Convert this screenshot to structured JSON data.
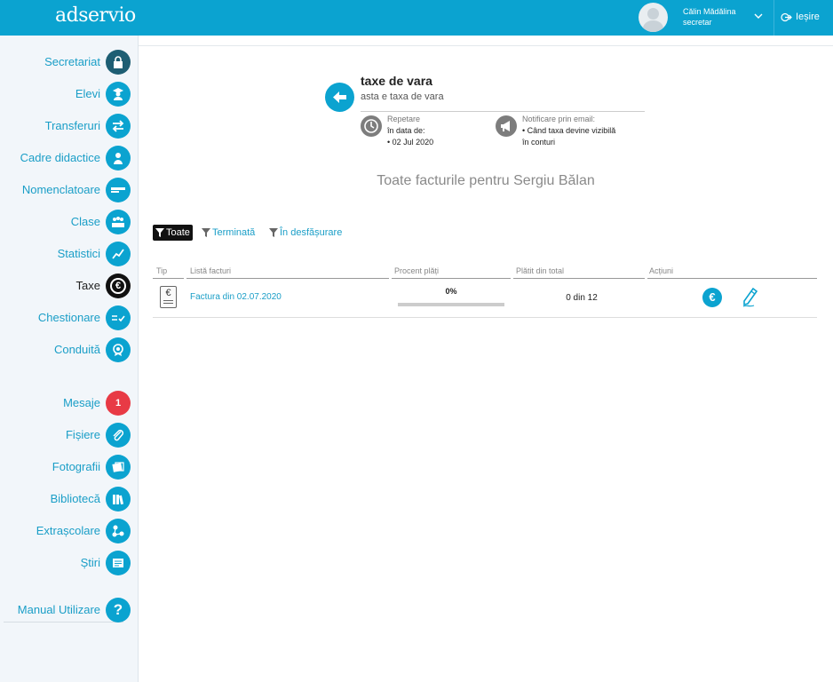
{
  "header": {
    "logo": "adservio",
    "user_name": "Călin Mădălina",
    "user_role": "secretar",
    "logout_label": "Ieșire"
  },
  "sidebar": {
    "items": [
      {
        "label": "Secretariat",
        "icon": "lock-icon"
      },
      {
        "label": "Elevi",
        "icon": "student-icon"
      },
      {
        "label": "Transferuri",
        "icon": "transfer-icon"
      },
      {
        "label": "Cadre didactice",
        "icon": "teacher-icon"
      },
      {
        "label": "Nomenclatoare",
        "icon": "list-icon"
      },
      {
        "label": "Clase",
        "icon": "class-icon"
      },
      {
        "label": "Statistici",
        "icon": "stats-icon"
      },
      {
        "label": "Taxe",
        "icon": "euro-icon"
      },
      {
        "label": "Chestionare",
        "icon": "survey-icon"
      },
      {
        "label": "Conduită",
        "icon": "award-icon"
      },
      {
        "label": "Mesaje",
        "badge": "1"
      },
      {
        "label": "Fișiere",
        "icon": "paperclip-icon"
      },
      {
        "label": "Fotografii",
        "icon": "photo-icon"
      },
      {
        "label": "Bibliotecă",
        "icon": "book-icon"
      },
      {
        "label": "Extrașcolare",
        "icon": "network-icon"
      },
      {
        "label": "Știri",
        "icon": "news-icon"
      },
      {
        "label": "Manual Utilizare",
        "icon": "help-icon"
      }
    ]
  },
  "fee": {
    "title": "taxe de vara",
    "subtitle": "asta e taxa de vara",
    "repeat_label": "Repetare",
    "repeat_on": "în data de:",
    "repeat_date": "• 02 Jul 2020",
    "notify_label": "Notificare prin email:",
    "notify_line1": "• Când taxa devine vizibilă",
    "notify_line2": "în conturi"
  },
  "main": {
    "heading": "Toate facturile pentru Sergiu Bălan"
  },
  "filters": {
    "all": "Toate",
    "done": "Terminată",
    "ongoing": "În desfășurare"
  },
  "table": {
    "headers": [
      "Tip",
      "Listă facturi",
      "Procent plăți",
      "Plătit din total",
      "Acțiuni"
    ],
    "rows": [
      {
        "type_icon": "invoice-euro-icon",
        "invoice": "Factura din 02.07.2020",
        "percent": "0%",
        "percent_value": 0,
        "paid": "0 din 12"
      }
    ]
  },
  "colors": {
    "accent": "#0ba3d0",
    "sidebar_bg": "#f2f6fa",
    "badge": "#e83a45"
  }
}
